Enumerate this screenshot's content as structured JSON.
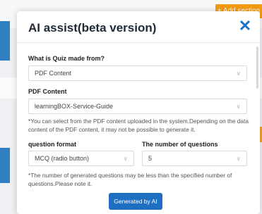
{
  "background": {
    "add_section_label": "+ Add section"
  },
  "modal": {
    "title": "AI assist(beta version)",
    "close_icon": "close-icon",
    "source": {
      "label": "What is Quiz made from?",
      "value": "PDF Content"
    },
    "pdf": {
      "label": "PDF Content",
      "value": "learningBOX-Service-Guide",
      "note": "*You can select from the PDF content uploaded in the system.Depending on the data content of the PDF content, it may not be possible to generate it."
    },
    "format": {
      "label": "question format",
      "value": "MCQ (radio button)"
    },
    "count": {
      "label": "The number of questions",
      "value": "5"
    },
    "count_note": "*The number of generated questions may be less than the specified number of questions.Please note it.",
    "generate_label": "Generated by AI"
  },
  "colors": {
    "accent": "#1e6fc1",
    "close": "#1a73c9",
    "add_section": "#f39c12"
  }
}
